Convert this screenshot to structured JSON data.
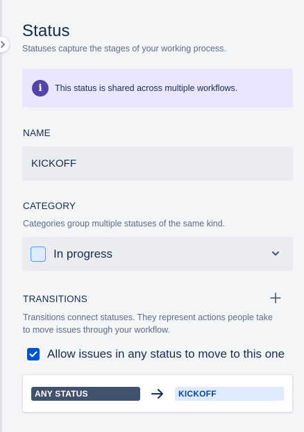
{
  "panel": {
    "title": "Status",
    "subtitle": "Statuses capture the stages of your working process."
  },
  "banner": {
    "icon": "info-icon",
    "icon_glyph": "i",
    "message": "This status is shared across multiple workflows.",
    "color": "#eae6ff"
  },
  "name_field": {
    "label": "NAME",
    "value": "KICKOFF"
  },
  "category": {
    "label": "CATEGORY",
    "help": "Categories group multiple statuses of the same kind.",
    "selected": "In progress",
    "swatch_color": "#deebff"
  },
  "transitions": {
    "label": "TRANSITIONS",
    "add_icon": "plus-icon",
    "help": "Transitions connect statuses. They represent actions people take to move issues through your workflow.",
    "allow_any": {
      "checked": true,
      "label": "Allow issues in any status to move to this one"
    },
    "rule": {
      "from": "ANY STATUS",
      "to": "KICKOFF",
      "arrow_icon": "arrow-right-icon"
    }
  },
  "colors": {
    "accent": "#0052cc",
    "text": "#172b4d",
    "subtle_text": "#5e6c84",
    "banner_icon": "#5243aa"
  }
}
